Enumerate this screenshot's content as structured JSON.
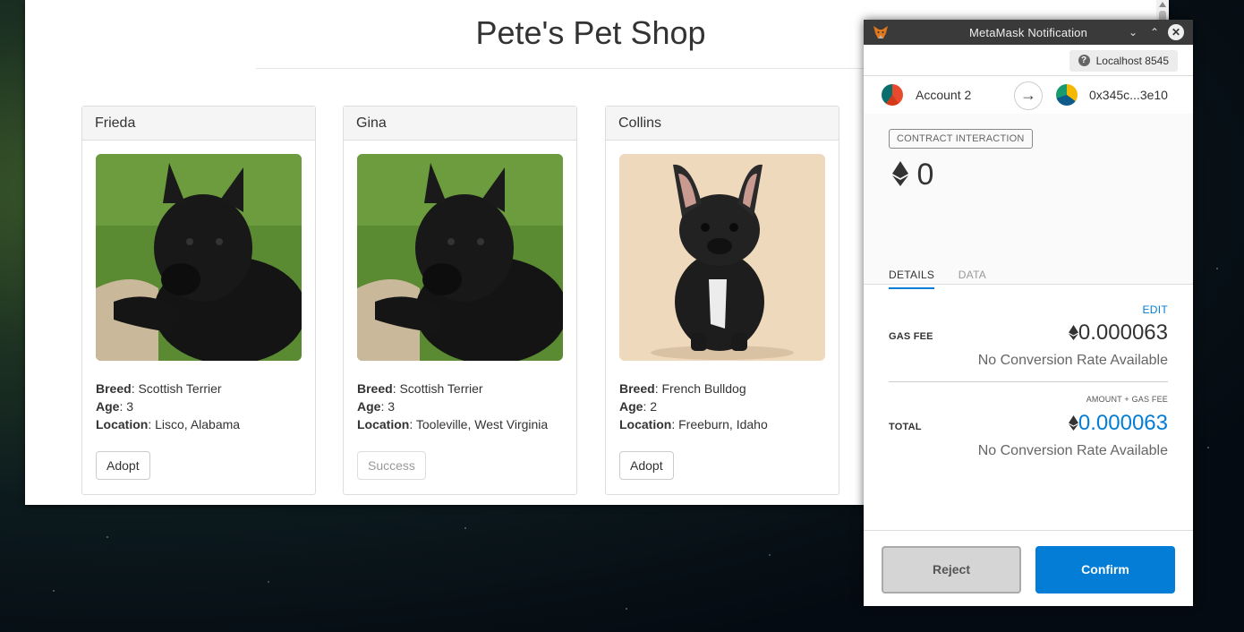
{
  "page": {
    "title": "Pete's Pet Shop",
    "pets": [
      {
        "name": "Frieda",
        "breed_label": "Breed",
        "breed": "Scottish Terrier",
        "age_label": "Age",
        "age": "3",
        "location_label": "Location",
        "location": "Lisco, Alabama",
        "button": "Adopt",
        "disabled": false
      },
      {
        "name": "Gina",
        "breed_label": "Breed",
        "breed": "Scottish Terrier",
        "age_label": "Age",
        "age": "3",
        "location_label": "Location",
        "location": "Tooleville, West Virginia",
        "button": "Success",
        "disabled": true
      },
      {
        "name": "Collins",
        "breed_label": "Breed",
        "breed": "French Bulldog",
        "age_label": "Age",
        "age": "2",
        "location_label": "Location",
        "location": "Freeburn, Idaho",
        "button": "Adopt",
        "disabled": false
      }
    ]
  },
  "metamask": {
    "window_title": "MetaMask Notification",
    "network": "Localhost 8545",
    "from_account": "Account 2",
    "to_address": "0x345c...3e10",
    "badge": "CONTRACT INTERACTION",
    "amount": "0",
    "tabs": {
      "details": "DETAILS",
      "data": "DATA"
    },
    "edit": "EDIT",
    "gas_fee_label": "GAS FEE",
    "gas_fee_value": "0.000063",
    "gas_conversion": "No Conversion Rate Available",
    "total_caption": "AMOUNT + GAS FEE",
    "total_label": "TOTAL",
    "total_value": "0.000063",
    "total_conversion": "No Conversion Rate Available",
    "reject": "Reject",
    "confirm": "Confirm",
    "colors": {
      "accent": "#037dd6",
      "titlebar": "#3a3a3a"
    }
  }
}
